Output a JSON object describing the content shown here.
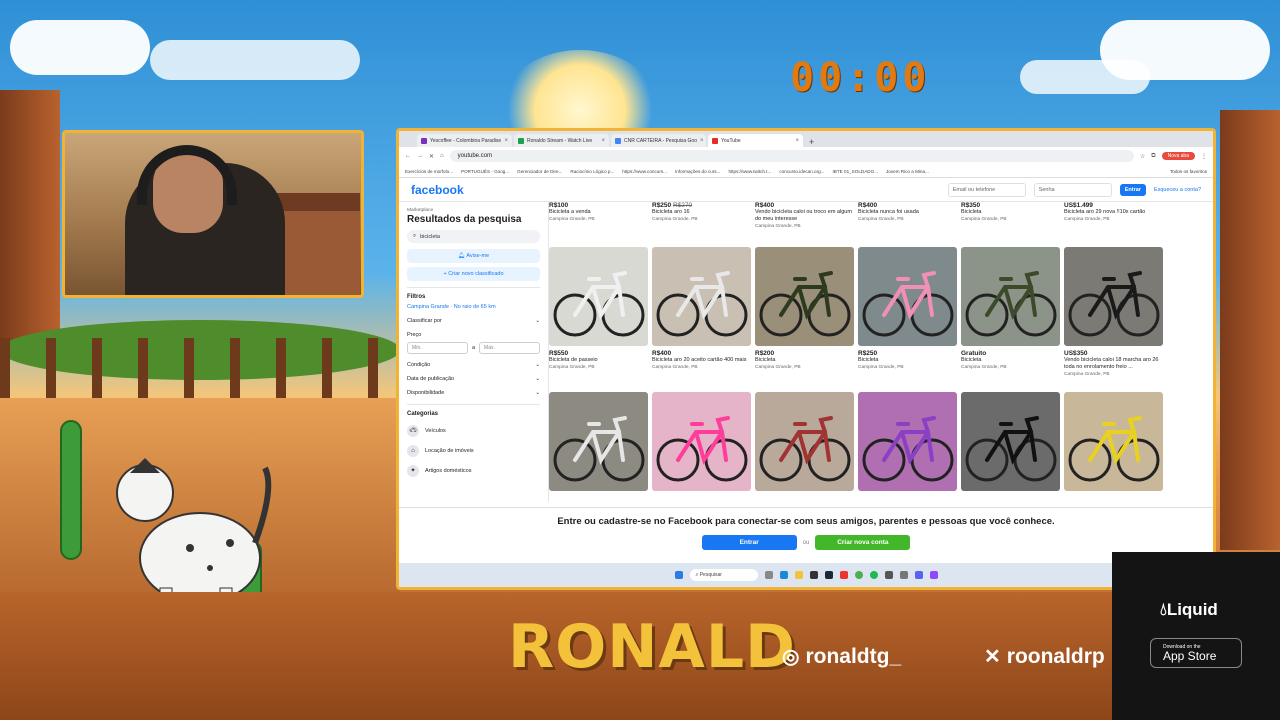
{
  "overlay": {
    "timer": "00:00",
    "streamer_name": "RONALD",
    "instagram": "ronaldtg_",
    "x_handle": "roonaldrp",
    "sponsor": {
      "name": "Liquid",
      "store_small": "Download on the",
      "store_big": "App Store"
    }
  },
  "browser": {
    "tabs": [
      {
        "label": "Yescoffee - Colombina Paradise",
        "color": "#7b2fbf"
      },
      {
        "label": "Ronaldo Stream - Watch Live",
        "color": "#1aa34a"
      },
      {
        "label": "CNR CARTEIRA - Pesquisa Goo",
        "color": "#4285f4"
      },
      {
        "label": "YouTube",
        "color": "#e52d27",
        "active": true
      }
    ],
    "url": "youtube.com",
    "profile_btn": "Nova aba",
    "bookmarks": [
      "Exercícios de morfolo...",
      "PORTUGUÊS - Goog...",
      "Gerenciador de Dire...",
      "Raciocínio Lógico p...",
      "https://www.concurs...",
      "Informações do curs...",
      "https://www.twitch.t...",
      "concurso.idecan.org...",
      "IBTE 01_SOLDADO...",
      "Jovem Rico a Mina...",
      "Todos os favoritos"
    ]
  },
  "facebook": {
    "logo": "facebook",
    "email_placeholder": "Email ou telefone",
    "password_placeholder": "Senha",
    "login_btn": "Entrar",
    "forgot": "Esqueceu a conta?",
    "sidebar": {
      "section": "Marketplace",
      "title": "Resultados da pesquisa",
      "search_value": "bicicleta",
      "alert_btn": "Avise-me",
      "create_btn": "Criar novo classificado",
      "filters_label": "Filtros",
      "location": "Campina Grande · No raio de 65 km",
      "sort_label": "Classificar por",
      "price_label": "Preço",
      "min": "Mín.",
      "to": "a",
      "max": "Máx.",
      "condition": "Condição",
      "date": "Data de publicação",
      "availability": "Disponibilidade",
      "categories_label": "Categorias",
      "categories": [
        "Veículos",
        "Locação de imóveis",
        "Artigos domésticos"
      ]
    },
    "top_row": [
      {
        "price": "R$100",
        "old": "",
        "title": "Bicicleta a venda",
        "loc": "Campina Grande, PB"
      },
      {
        "price": "R$250",
        "old": "R$270",
        "title": "Bicicleta aro 16",
        "loc": "Campina Grande, PB"
      },
      {
        "price": "R$400",
        "old": "",
        "title": "Vendo bicicleta caloi ou troco em algum do meu interesse",
        "loc": "Campina Grande, PB"
      },
      {
        "price": "R$400",
        "old": "",
        "title": "Bicicleta nunca foi usada",
        "loc": "Campina Grande, PB"
      },
      {
        "price": "R$350",
        "old": "",
        "title": "Bicicleta",
        "loc": "Campina Grande, PB"
      },
      {
        "price": "US$1.499",
        "old": "",
        "title": "Bicicleta aro 29 nova !!10x cartão",
        "loc": "Campina Grande, PB"
      }
    ],
    "mid_row": [
      {
        "price": "R$550",
        "title": "Bicicleta de passeio",
        "loc": "Campina Grande, PB",
        "bg": "#d9d9d4",
        "frame": "#f0f0f0"
      },
      {
        "price": "R$400",
        "title": "Bicicleta aro 20 aceito cartão 400 mais",
        "loc": "Campina Grande, PB",
        "bg": "#c9c0b3",
        "frame": "#e8e8e8"
      },
      {
        "price": "R$200",
        "title": "Bicicleta",
        "loc": "Campina Grande, PB",
        "bg": "#9a8f78",
        "frame": "#2d3a1e"
      },
      {
        "price": "R$250",
        "title": "Bicicleta",
        "loc": "Campina Grande, PB",
        "bg": "#7f8a8c",
        "frame": "#f28fb8"
      },
      {
        "price": "Gratuito",
        "title": "Bicicleta",
        "loc": "Campina Grande, PB",
        "bg": "#8c9489",
        "frame": "#3b4a2a"
      },
      {
        "price": "US$350",
        "title": "Vendo bicicleta caloi 18 marcha aro 26 toda no enrolamento freio ...",
        "loc": "Campina Grande, PB",
        "bg": "#7c7a74",
        "frame": "#1a1a1a"
      }
    ],
    "bottom_row": [
      {
        "bg": "#8d8a82",
        "frame": "#e6e6e6"
      },
      {
        "bg": "#e6b4c8",
        "frame": "#ff3d9a"
      },
      {
        "bg": "#b9a99a",
        "frame": "#a13333"
      },
      {
        "bg": "#b06fb0",
        "frame": "#8a3fc4"
      },
      {
        "bg": "#6b6b6b",
        "frame": "#111111"
      },
      {
        "bg": "#c9b79a",
        "frame": "#e8d21f"
      }
    ],
    "banner_text": "Entre ou cadastre-se no Facebook para conectar-se com seus amigos, parentes e pessoas que você conhece.",
    "banner_login": "Entrar",
    "banner_or": "ou",
    "banner_signup": "Criar nova conta"
  },
  "taskbar": {
    "search": "Pesquisar"
  }
}
